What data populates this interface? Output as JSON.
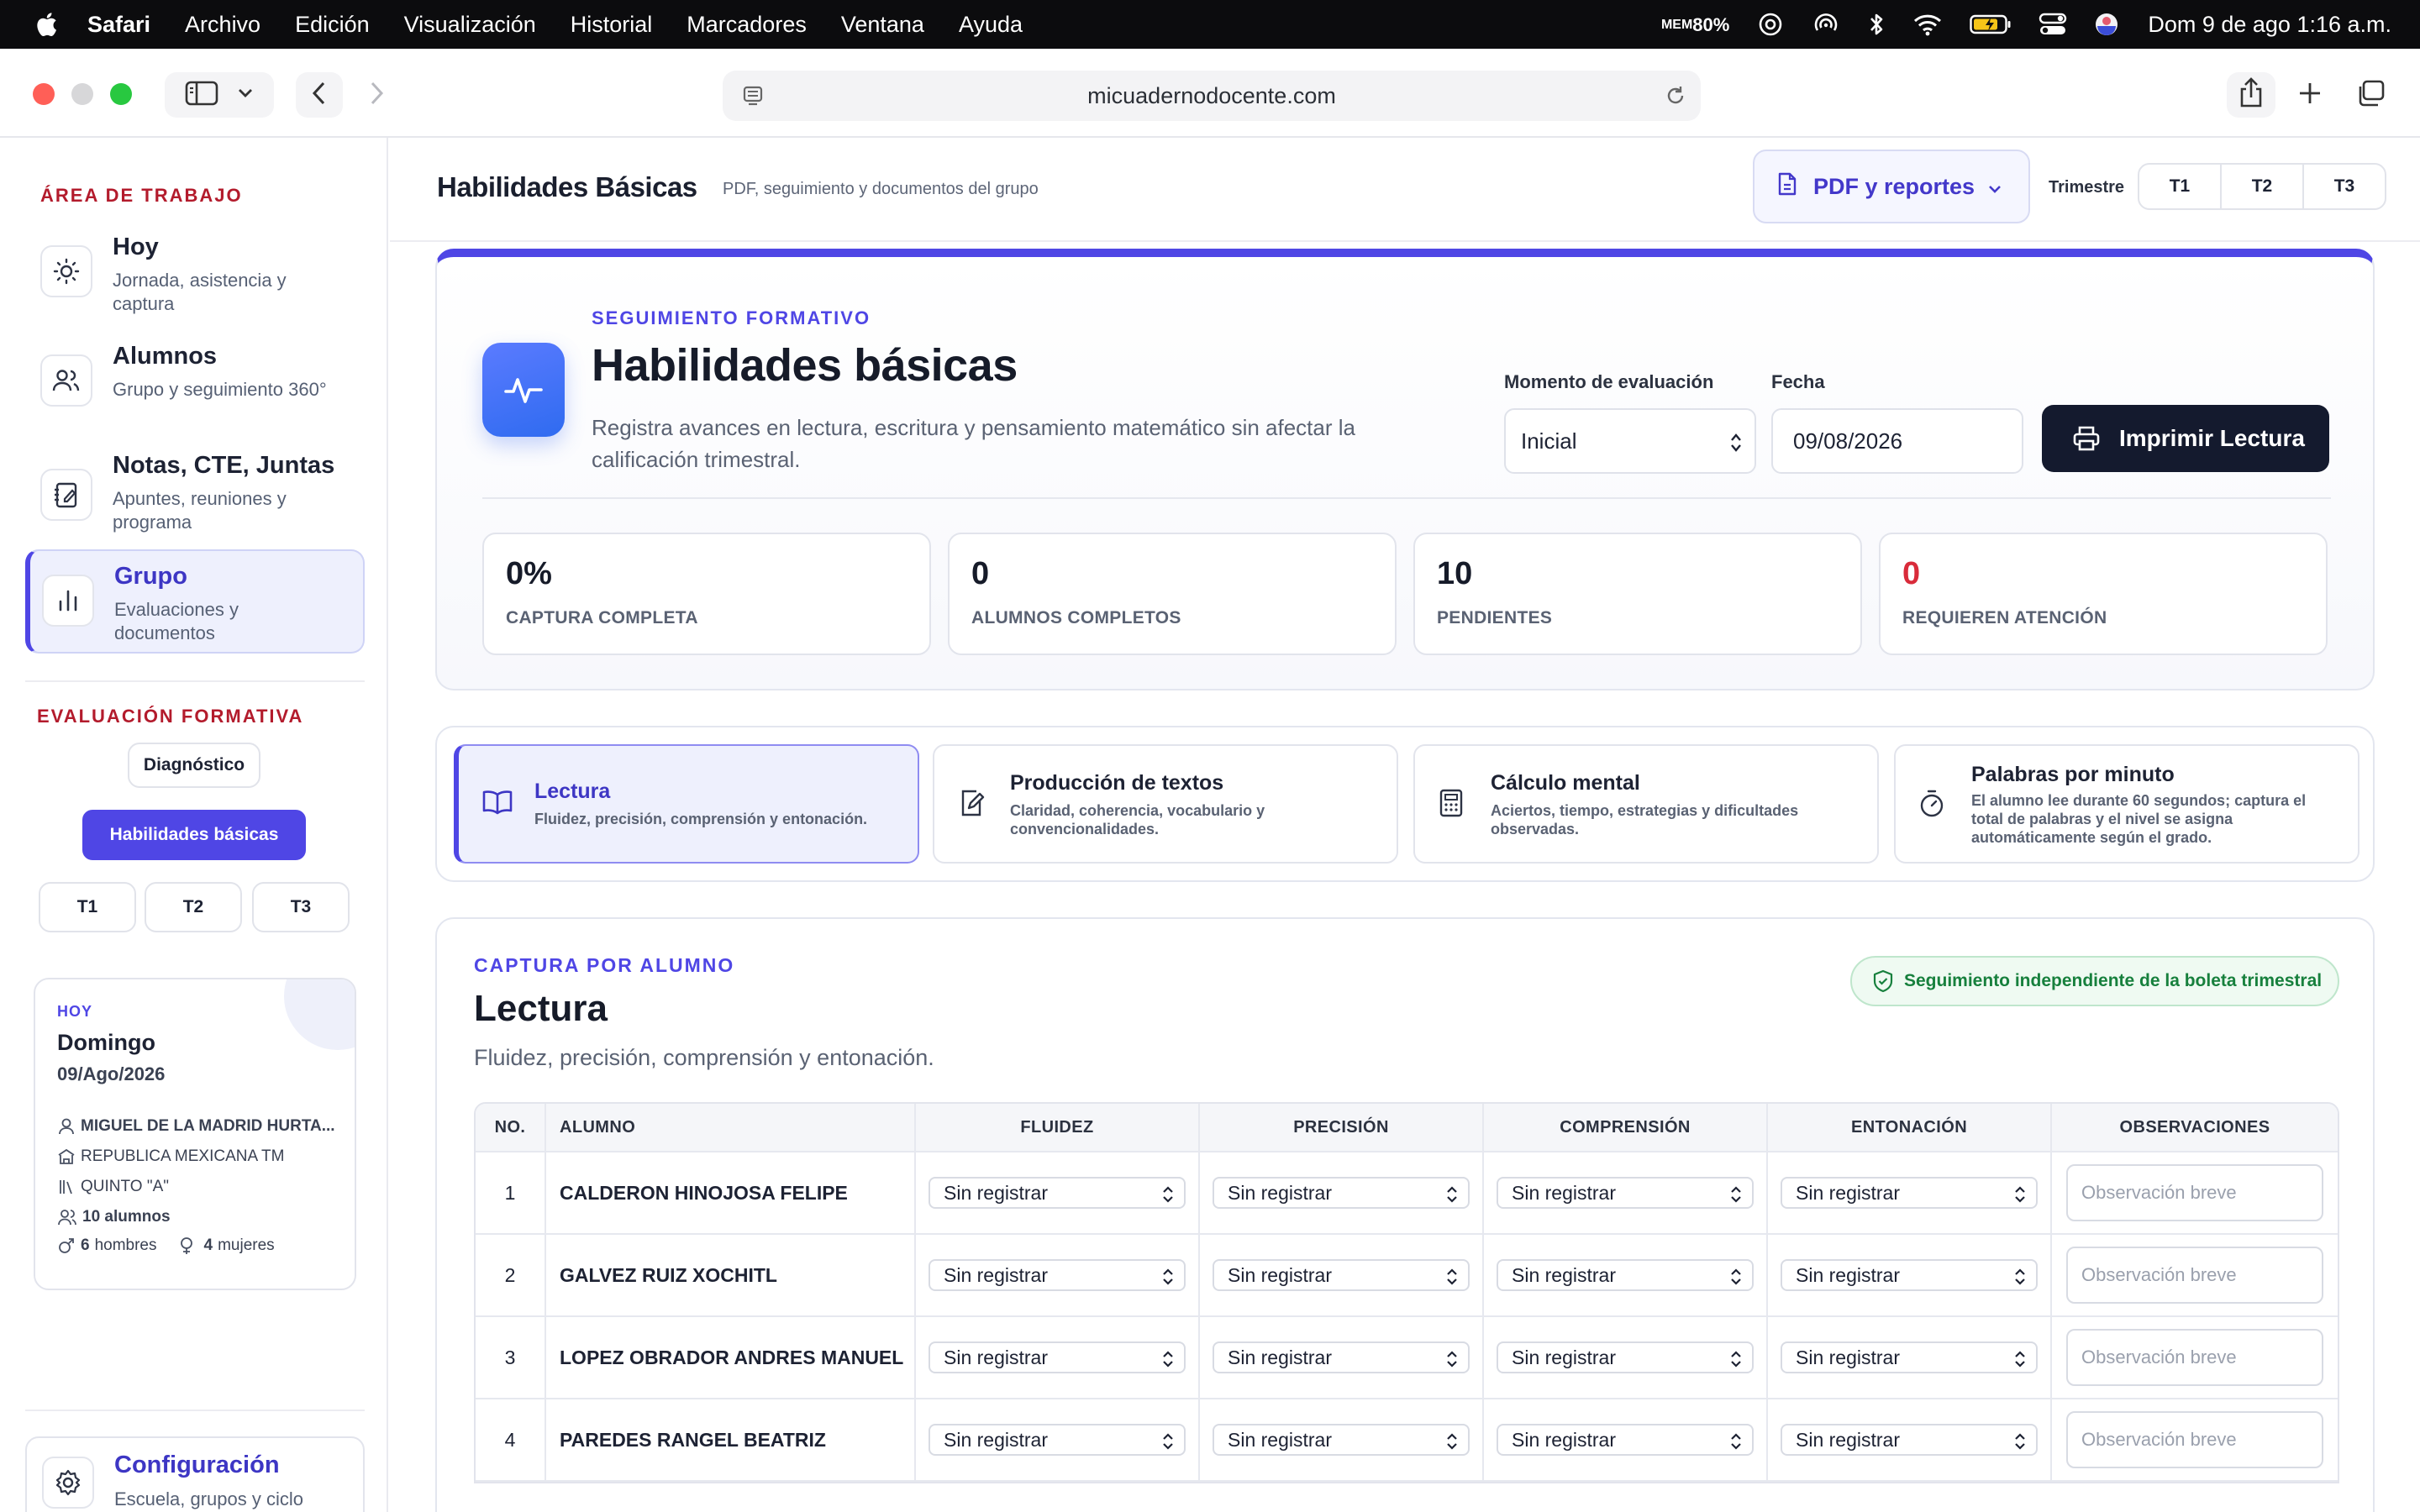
{
  "menubar": {
    "app_name": "Safari",
    "menus": [
      "Archivo",
      "Edición",
      "Visualización",
      "Historial",
      "Marcadores",
      "Ventana",
      "Ayuda"
    ],
    "mem_label": "MEM",
    "mem_value": "80%",
    "clock": "Dom 9 de ago  1:16 a.m."
  },
  "browser": {
    "url": "micuadernodocente.com"
  },
  "sidebar": {
    "section_work": "ÁREA DE TRABAJO",
    "items": [
      {
        "title": "Hoy",
        "subtitle": "Jornada, asistencia y captura",
        "icon": "sun-icon"
      },
      {
        "title": "Alumnos",
        "subtitle": "Grupo y seguimiento 360°",
        "icon": "users-icon"
      },
      {
        "title": "Notas, CTE, Juntas",
        "subtitle": "Apuntes, reuniones y programa",
        "icon": "notebook-icon"
      },
      {
        "title": "Grupo",
        "subtitle": "Evaluaciones y documentos",
        "icon": "bar-chart-icon"
      }
    ],
    "section_eval": "EVALUACIÓN FORMATIVA",
    "diagnostic_label": "Diagnóstico",
    "basic_skills_label": "Habilidades básicas",
    "trimesters": [
      "T1",
      "T2",
      "T3"
    ],
    "today": {
      "kicker": "HOY",
      "day": "Domingo",
      "date": "09/Ago/2026",
      "teacher": "MIGUEL DE LA MADRID HURTA...",
      "school": "REPUBLICA MEXICANA TM",
      "group": "QUINTO \"A\"",
      "students": "10 alumnos",
      "men_count": "6",
      "men_label": "hombres",
      "women_count": "4",
      "women_label": "mujeres"
    },
    "config": {
      "title": "Configuración",
      "subtitle": "Escuela, grupos y ciclo"
    }
  },
  "header": {
    "title": "Habilidades Básicas",
    "subtitle": "PDF, seguimiento y documentos del grupo",
    "pdf_button": "PDF y reportes",
    "trimester_label": "Trimestre",
    "trimesters": [
      "T1",
      "T2",
      "T3"
    ]
  },
  "hero": {
    "kicker": "SEGUIMIENTO FORMATIVO",
    "title": "Habilidades básicas",
    "description": "Registra avances en lectura, escritura y pensamiento matemático sin afectar la calificación trimestral.",
    "moment_label": "Momento de evaluación",
    "moment_value": "Inicial",
    "date_label": "Fecha",
    "date_value": "09/08/2026",
    "print_button": "Imprimir Lectura",
    "kpis": [
      {
        "value": "0%",
        "caption": "CAPTURA COMPLETA"
      },
      {
        "value": "0",
        "caption": "ALUMNOS COMPLETOS"
      },
      {
        "value": "10",
        "caption": "PENDIENTES"
      },
      {
        "value": "0",
        "caption": "REQUIEREN ATENCIÓN"
      }
    ]
  },
  "skills": [
    {
      "title": "Lectura",
      "subtitle": "Fluidez, precisión, comprensión y entonación."
    },
    {
      "title": "Producción de textos",
      "subtitle": "Claridad, coherencia, vocabulario y convencionalidades."
    },
    {
      "title": "Cálculo mental",
      "subtitle": "Aciertos, tiempo, estrategias y dificultades observadas."
    },
    {
      "title": "Palabras por minuto",
      "subtitle": "El alumno lee durante 60 segundos; captura el total de palabras y el nivel se asigna automáticamente según el grado."
    }
  ],
  "capture": {
    "kicker": "CAPTURA POR ALUMNO",
    "title": "Lectura",
    "description": "Fluidez, precisión, comprensión y entonación.",
    "independent_badge": "Seguimiento independiente de la boleta trimestral",
    "columns": [
      "NO.",
      "ALUMNO",
      "FLUIDEZ",
      "PRECISIÓN",
      "COMPRENSIÓN",
      "ENTONACIÓN",
      "OBSERVACIONES"
    ],
    "select_default": "Sin registrar",
    "obs_placeholder": "Observación breve",
    "rows": [
      {
        "no": "1",
        "name": "CALDERON HINOJOSA FELIPE"
      },
      {
        "no": "2",
        "name": "GALVEZ RUIZ XOCHITL"
      },
      {
        "no": "3",
        "name": "LOPEZ OBRADOR ANDRES MANUEL"
      },
      {
        "no": "4",
        "name": "PAREDES RANGEL BEATRIZ"
      }
    ]
  }
}
